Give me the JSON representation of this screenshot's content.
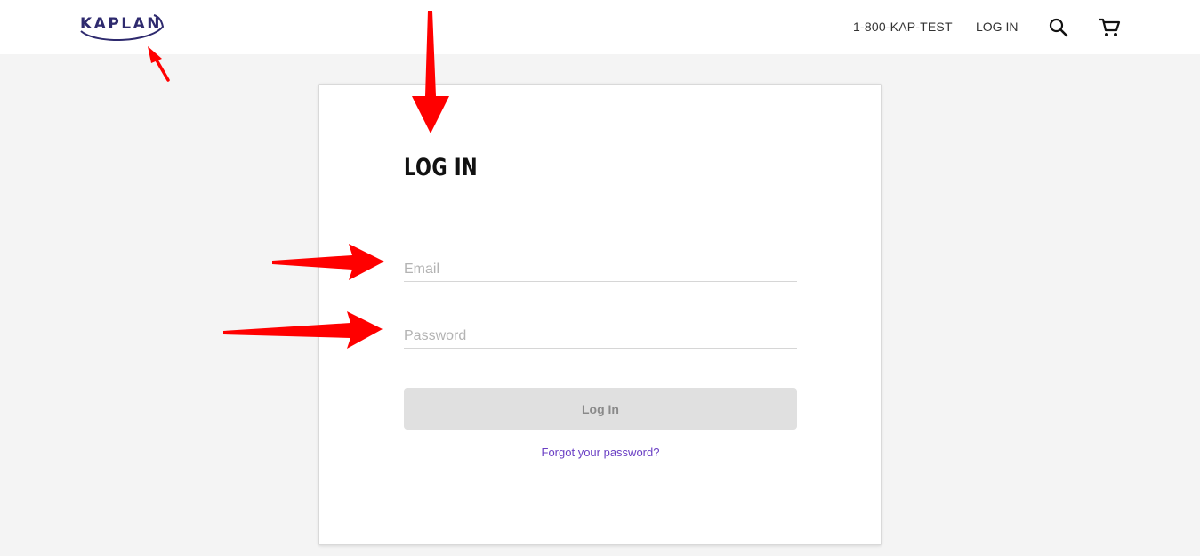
{
  "header": {
    "logo_text": "KAPLAN",
    "phone": "1-800-KAP-TEST",
    "login_link": "LOG IN",
    "search_icon": "search-icon",
    "cart_icon": "cart-icon"
  },
  "login_form": {
    "title": "LOG IN",
    "email_placeholder": "Email",
    "email_value": "",
    "password_placeholder": "Password",
    "password_value": "",
    "submit_label": "Log In",
    "forgot_link": "Forgot your password?"
  },
  "colors": {
    "brand": "#2e2a6e",
    "link": "#6a3fc4",
    "button_disabled_bg": "#e0e0e0",
    "annotation_arrow": "#ff0000"
  }
}
